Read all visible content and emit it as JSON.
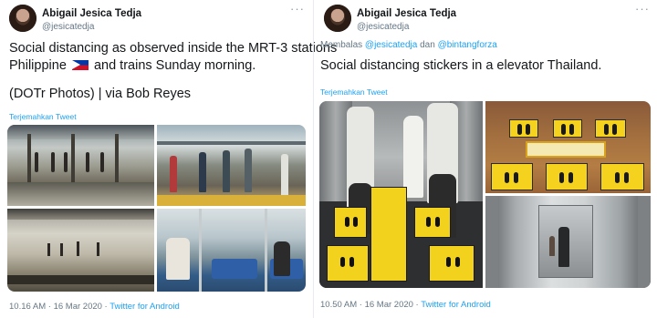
{
  "left_tweet": {
    "author_name": "Abigail Jesica Tedja",
    "author_handle": "@jesicatedja",
    "more_icon": "···",
    "text_line1": "Social distancing as observed inside the MRT-3 stations",
    "text_line2_before": "Philippine",
    "text_line2_after": "and trains Sunday morning.",
    "flag_icon": "philippines-flag-icon",
    "text_line3": "(DOTr Photos) | via Bob Reyes",
    "translate_label": "Terjemahkan Tweet",
    "timestamp": "10.16 AM · 16 Mar 2020 ·",
    "source": "Twitter for Android"
  },
  "right_tweet": {
    "author_name": "Abigail Jesica Tedja",
    "author_handle": "@jesicatedja",
    "more_icon": "···",
    "reply_prefix": "Membalas",
    "reply_mention1": "@jesicatedja",
    "reply_connector": "dan",
    "reply_mention2": "@bintangforza",
    "text": "Social distancing stickers in a elevator Thailand.",
    "translate_label": "Terjemahkan Tweet",
    "timestamp": "10.50 AM · 16 Mar 2020 ·",
    "source": "Twitter for Android"
  },
  "colors": {
    "link": "#1da1f2",
    "muted": "#657786",
    "text": "#14171a"
  }
}
